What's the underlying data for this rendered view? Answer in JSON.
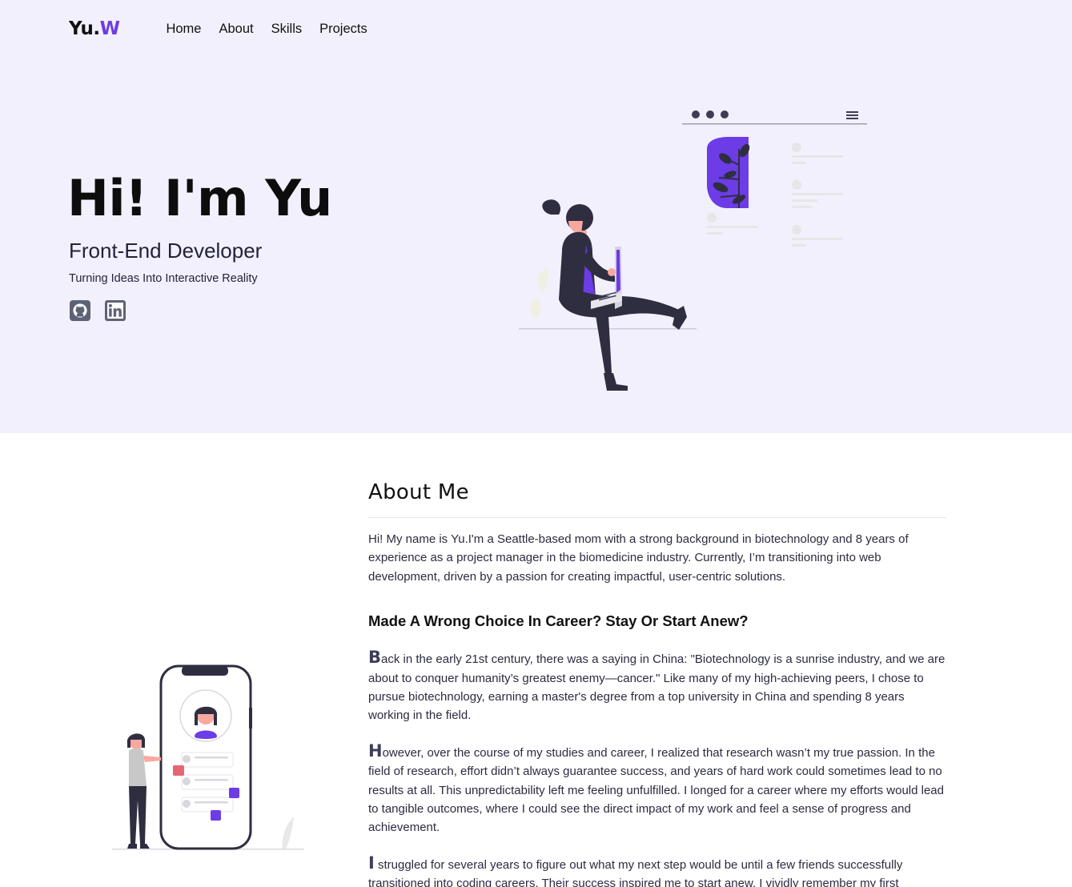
{
  "nav": {
    "logo_main": "Yu.",
    "logo_accent": "W",
    "items": [
      "Home",
      "About",
      "Skills",
      "Projects"
    ]
  },
  "hero": {
    "title": "Hi! I'm Yu",
    "role": "Front-End Developer",
    "tagline": "Turning Ideas Into Interactive Reality",
    "socials": [
      {
        "name": "github-icon"
      },
      {
        "name": "linkedin-icon"
      }
    ]
  },
  "about": {
    "heading": "About Me",
    "intro": "Hi! My name is Yu.I'm a Seattle-based mom with a strong background in biotechnology and 8 years of experience as a project manager in the biomedicine industry. Currently, I’m transitioning into web development, driven by a passion for creating impactful, user-centric solutions.",
    "subheading": "Made A Wrong Choice In Career? Stay Or Start Anew?",
    "paragraphs": [
      {
        "initial": "B",
        "text": "ack in the early 21st century, there was a saying in China: \"Biotechnology is a sunrise industry, and we are about to conquer humanity’s greatest enemy—cancer.\" Like many of my high-achieving peers, I chose to pursue biotechnology, earning a master's degree from a top university in China and spending 8 years working in the field."
      },
      {
        "initial": "H",
        "text": "owever, over the course of my studies and career, I realized that research wasn’t my true passion. In the field of research, effort didn’t always guarantee success, and years of hard work could sometimes lead to no results at all. This unpredictability left me feeling unfulfilled. I longed for a career where my efforts would lead to tangible outcomes, where I could see the direct impact of my work and feel a sense of progress and achievement."
      },
      {
        "initial": "I",
        "text": " struggled for several years to figure out what my next step would be until a few friends successfully transitioned into coding careers. Their success inspired me to start anew. I vividly remember my first"
      }
    ]
  },
  "colors": {
    "accent": "#6c3ce6",
    "hero_bg": "#f3f0fd",
    "dark": "#2f2e41"
  }
}
